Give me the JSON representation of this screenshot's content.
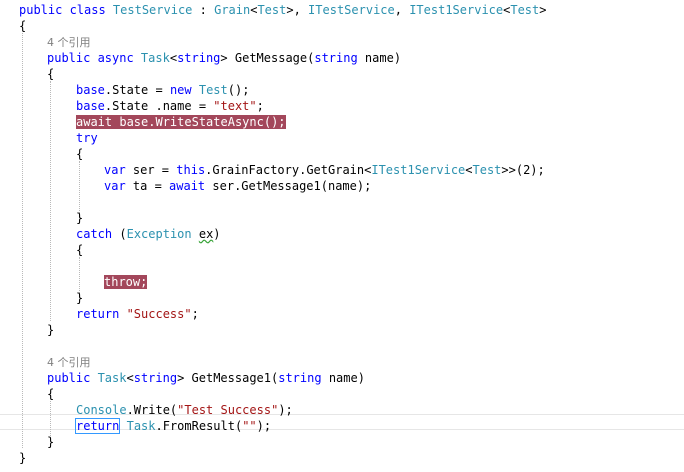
{
  "code_lines": [
    {
      "tokens": [
        [
          "kw",
          "public class "
        ],
        [
          "ty",
          "TestService"
        ],
        [
          "pl",
          " : "
        ],
        [
          "ty",
          "Grain"
        ],
        [
          "pl",
          "<"
        ],
        [
          "ty",
          "Test"
        ],
        [
          "pl",
          ">, "
        ],
        [
          "ty",
          "ITestService"
        ],
        [
          "pl",
          ", "
        ],
        [
          "ty",
          "ITest1Service"
        ],
        [
          "pl",
          "<"
        ],
        [
          "ty",
          "Test"
        ],
        [
          "pl",
          ">"
        ]
      ]
    },
    {
      "tokens": [
        [
          "pl",
          "{"
        ]
      ]
    },
    {
      "codelens": "4 个引用"
    },
    {
      "tokens": [
        [
          "kw",
          "public async "
        ],
        [
          "ty",
          "Task"
        ],
        [
          "pl",
          "<"
        ],
        [
          "kw",
          "string"
        ],
        [
          "pl",
          "> GetMessage("
        ],
        [
          "kw",
          "string"
        ],
        [
          "pl",
          " name)"
        ]
      ]
    },
    {
      "tokens": [
        [
          "pl",
          "{"
        ]
      ]
    },
    {
      "tokens": [
        [
          "kw",
          "base"
        ],
        [
          "pl",
          ".State = "
        ],
        [
          "kw",
          "new "
        ],
        [
          "ty",
          "Test"
        ],
        [
          "pl",
          "();"
        ]
      ]
    },
    {
      "tokens": [
        [
          "kw",
          "base"
        ],
        [
          "pl",
          ".State .name = "
        ],
        [
          "st",
          "\"text\""
        ],
        [
          "pl",
          ";"
        ]
      ]
    },
    {
      "highlight": "await base.WriteStateAsync();"
    },
    {
      "tokens": [
        [
          "kw",
          "try"
        ]
      ]
    },
    {
      "tokens": [
        [
          "pl",
          "{"
        ]
      ]
    },
    {
      "tokens": [
        [
          "kw",
          "var "
        ],
        [
          "pl",
          "ser = "
        ],
        [
          "kw",
          "this"
        ],
        [
          "pl",
          ".GrainFactory.GetGrain<"
        ],
        [
          "ty",
          "ITest1Service"
        ],
        [
          "pl",
          "<"
        ],
        [
          "ty",
          "Test"
        ],
        [
          "pl",
          ">>(2);"
        ]
      ]
    },
    {
      "tokens": [
        [
          "kw",
          "var "
        ],
        [
          "pl",
          "ta = "
        ],
        [
          "kw",
          "await "
        ],
        [
          "pl",
          "ser.GetMessage1(name);"
        ]
      ]
    },
    {
      "tokens": []
    },
    {
      "tokens": [
        [
          "pl",
          "}"
        ]
      ]
    },
    {
      "tokens": [
        [
          "kw",
          "catch "
        ],
        [
          "pl",
          "("
        ],
        [
          "ty",
          "Exception "
        ],
        [
          "sq",
          "ex"
        ],
        [
          "pl",
          ")"
        ]
      ]
    },
    {
      "tokens": [
        [
          "pl",
          "{"
        ]
      ]
    },
    {
      "tokens": []
    },
    {
      "highlight": "throw;"
    },
    {
      "tokens": [
        [
          "pl",
          "}"
        ]
      ]
    },
    {
      "tokens": [
        [
          "kw",
          "return "
        ],
        [
          "st",
          "\"Success\""
        ],
        [
          "pl",
          ";"
        ]
      ]
    },
    {
      "tokens": [
        [
          "pl",
          "}"
        ]
      ]
    },
    {
      "tokens": []
    },
    {
      "codelens": "4 个引用"
    },
    {
      "tokens": [
        [
          "kw",
          "public "
        ],
        [
          "ty",
          "Task"
        ],
        [
          "pl",
          "<"
        ],
        [
          "kw",
          "string"
        ],
        [
          "pl",
          "> GetMessage1("
        ],
        [
          "kw",
          "string"
        ],
        [
          "pl",
          " name)"
        ]
      ]
    },
    {
      "tokens": [
        [
          "pl",
          "{"
        ]
      ]
    },
    {
      "tokens": [
        [
          "ty",
          "Console"
        ],
        [
          "pl",
          ".Write("
        ],
        [
          "st",
          "\"Test Success\""
        ],
        [
          "pl",
          ");"
        ]
      ]
    },
    {
      "tokens": [
        [
          "selkw",
          "return"
        ],
        [
          "pl",
          " "
        ],
        [
          "ty",
          "Task"
        ],
        [
          "pl",
          ".FromResult("
        ],
        [
          "st",
          "\"\""
        ],
        [
          "pl",
          ");"
        ]
      ]
    },
    {
      "tokens": [
        [
          "pl",
          "}"
        ]
      ]
    },
    {
      "tokens": [
        [
          "pl",
          "}"
        ]
      ]
    }
  ],
  "colors": {
    "keyword": "#0000ff",
    "type": "#2b91af",
    "string": "#a31515",
    "breakpoint_highlight": "#a3475b",
    "codelens": "#808080"
  }
}
